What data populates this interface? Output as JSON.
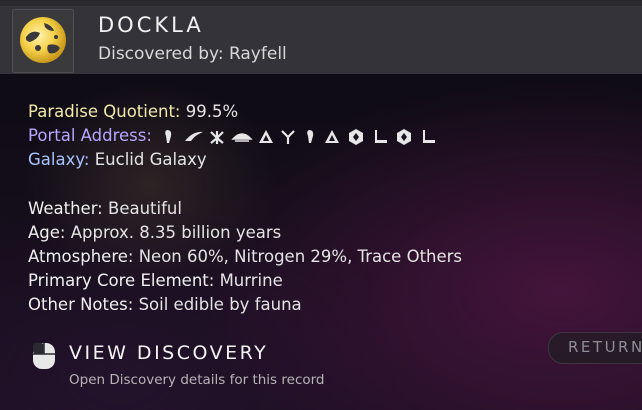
{
  "header": {
    "title": "DOCKLA",
    "subtitle": "Discovered by: Rayfell",
    "icon": "planet-icon"
  },
  "details": {
    "paradise": {
      "label": "Paradise Quotient:",
      "value": "99.5%",
      "color": "#f2e9a8"
    },
    "portal": {
      "label": "Portal Address:",
      "color": "#b7a6ff",
      "glyphs": [
        "glyph-1",
        "glyph-2",
        "glyph-3",
        "glyph-4",
        "glyph-5",
        "glyph-6",
        "glyph-7",
        "glyph-8",
        "glyph-9",
        "glyph-10",
        "glyph-11",
        "glyph-12"
      ]
    },
    "galaxy": {
      "label": "Galaxy:",
      "value": "Euclid Galaxy",
      "color": "#a9c4ff"
    },
    "weather": {
      "label": "Weather:",
      "value": "Beautiful"
    },
    "age": {
      "label": "Age:",
      "value": "Approx. 8.35 billion years"
    },
    "atmosphere": {
      "label": "Atmosphere:",
      "value": "Neon 60%, Nitrogen 29%, Trace Others"
    },
    "core": {
      "label": "Primary Core Element:",
      "value": "Murrine"
    },
    "notes": {
      "label": "Other Notes:",
      "value": "Soil edible by fauna"
    }
  },
  "action": {
    "title": "VIEW DISCOVERY",
    "subtitle": "Open Discovery details for this record",
    "icon": "mouse-icon"
  },
  "return_button": {
    "label": "RETURN"
  }
}
